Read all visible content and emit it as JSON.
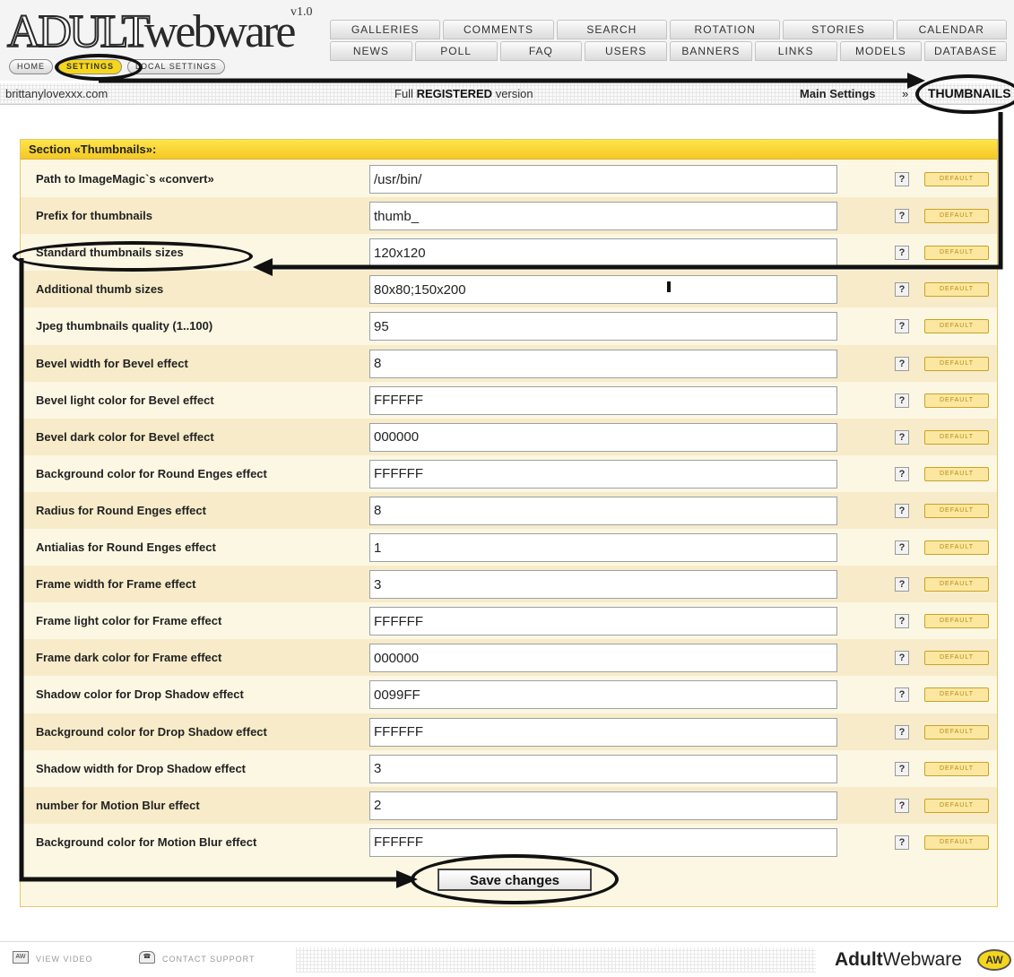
{
  "header": {
    "logo_main": "ADULT",
    "logo_secondary": "webware",
    "logo_version": "v1.0",
    "subtabs": [
      {
        "label": "HOME",
        "active": false
      },
      {
        "label": "SETTINGS",
        "active": true
      },
      {
        "label": "LOCAL SETTINGS",
        "active": false
      }
    ],
    "tabs_row1": [
      "GALLERIES",
      "COMMENTS",
      "SEARCH",
      "ROTATION",
      "STORIES",
      "CALENDAR"
    ],
    "tabs_row2": [
      "NEWS",
      "POLL",
      "FAQ",
      "USERS",
      "BANNERS",
      "LINKS",
      "MODELS",
      "DATABASE"
    ]
  },
  "infobar": {
    "site": "brittanylovexxx.com",
    "version_prefix": "Full ",
    "version_bold": "REGISTERED",
    "version_suffix": " version",
    "breadcrumb_main": "Main Settings",
    "breadcrumb_sep": "»",
    "breadcrumb_current": "THUMBNAILS"
  },
  "section": {
    "title": "Section «Thumbnails»:",
    "help_label": "?",
    "default_label": "DEFAULT",
    "rows": [
      {
        "label": "Path to ImageMagic`s «convert»",
        "value": "/usr/bin/"
      },
      {
        "label": "Prefix for thumbnails",
        "value": "thumb_"
      },
      {
        "label": "Standard thumbnails sizes",
        "value": "120x120"
      },
      {
        "label": "Additional thumb sizes",
        "value": "80x80;150x200"
      },
      {
        "label": "Jpeg thumbnails quality (1..100)",
        "value": "95"
      },
      {
        "label": "Bevel width for Bevel effect",
        "value": "8"
      },
      {
        "label": "Bevel light color for Bevel effect",
        "value": "FFFFFF"
      },
      {
        "label": "Bevel dark color for Bevel effect",
        "value": "000000"
      },
      {
        "label": "Background color for Round Enges effect",
        "value": "FFFFFF"
      },
      {
        "label": "Radius for Round Enges effect",
        "value": "8"
      },
      {
        "label": "Antialias for Round Enges effect",
        "value": "1"
      },
      {
        "label": "Frame width for Frame effect",
        "value": "3"
      },
      {
        "label": "Frame light color for Frame effect",
        "value": "FFFFFF"
      },
      {
        "label": "Frame dark color for Frame effect",
        "value": "000000"
      },
      {
        "label": "Shadow color for Drop Shadow effect",
        "value": "0099FF"
      },
      {
        "label": "Background color for Drop Shadow effect",
        "value": "FFFFFF"
      },
      {
        "label": "Shadow width for Drop Shadow effect",
        "value": "3"
      },
      {
        "label": "number for Motion Blur effect",
        "value": "2"
      },
      {
        "label": "Background color for Motion Blur effect",
        "value": "FFFFFF"
      }
    ],
    "save_label": "Save changes"
  },
  "footer": {
    "view_video": "VIEW VIDEO",
    "contact_support": "CONTACT SUPPORT",
    "video_icon_text": "AW",
    "brand_bold": "Adult",
    "brand_rest": "Webware",
    "brand_badge": "AW"
  },
  "colors": {
    "accent_yellow": "#f6d61c",
    "panel_bg": "#fcf7e3",
    "panel_alt_row": "#f7ebc9",
    "default_button": "#fbe7a0"
  }
}
